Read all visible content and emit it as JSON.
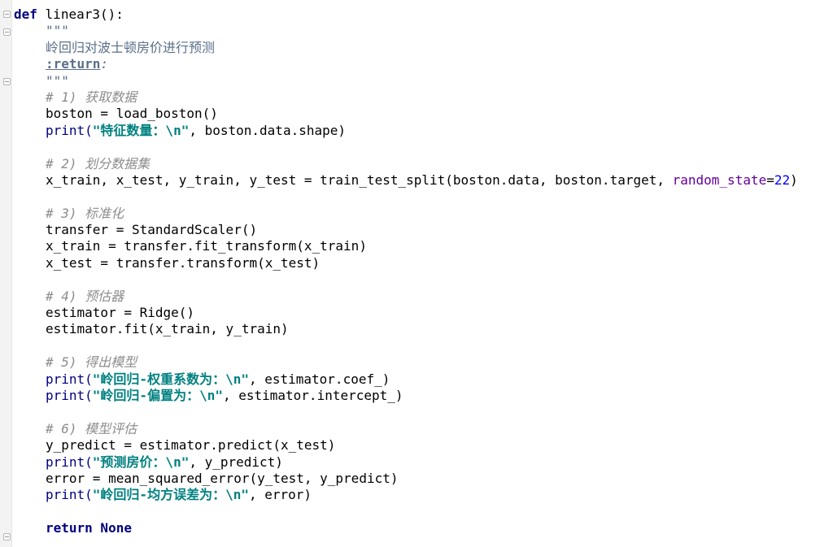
{
  "code": {
    "def_kw": "def",
    "func_sig": "linear3():",
    "doc_quotes_open": "\"\"\"",
    "doc_desc": "岭回归对波士顿房价进行预测",
    "doc_return_tag": ":return",
    "doc_return_colon": ":",
    "doc_quotes_close": "\"\"\"",
    "c1": "# 1) 获取数据",
    "l1": "boston = load_boston()",
    "p1_fn": "print(",
    "p1_str": "\"特征数量：\\n\"",
    "p1_rest": ", boston.data.shape)",
    "c2": "# 2) 划分数据集",
    "l2a": "x_train, x_test, y_train, y_test = train_test_split(boston.data, boston.target, ",
    "l2_kw": "random_state",
    "l2_eq": "=",
    "l2_num": "22",
    "l2_close": ")",
    "c3": "# 3) 标准化",
    "l3a": "transfer = StandardScaler()",
    "l3b": "x_train = transfer.fit_transform(x_train)",
    "l3c": "x_test = transfer.transform(x_test)",
    "c4": "# 4) 预估器",
    "l4a": "estimator = Ridge()",
    "l4b": "estimator.fit(x_train, y_train)",
    "c5": "# 5) 得出模型",
    "p5a_fn": "print(",
    "p5a_str": "\"岭回归-权重系数为：\\n\"",
    "p5a_rest": ", estimator.coef_)",
    "p5b_fn": "print(",
    "p5b_str": "\"岭回归-偏置为：\\n\"",
    "p5b_rest": ", estimator.intercept_)",
    "c6": "# 6) 模型评估",
    "l6a": "y_predict = estimator.predict(x_test)",
    "p6a_fn": "print(",
    "p6a_str": "\"预测房价：\\n\"",
    "p6a_rest": ", y_predict)",
    "l6b": "error = mean_squared_error(y_test, y_predict)",
    "p6b_fn": "print(",
    "p6b_str": "\"岭回归-均方误差为：\\n\"",
    "p6b_rest": ", error)",
    "ret_kw": "return None"
  }
}
